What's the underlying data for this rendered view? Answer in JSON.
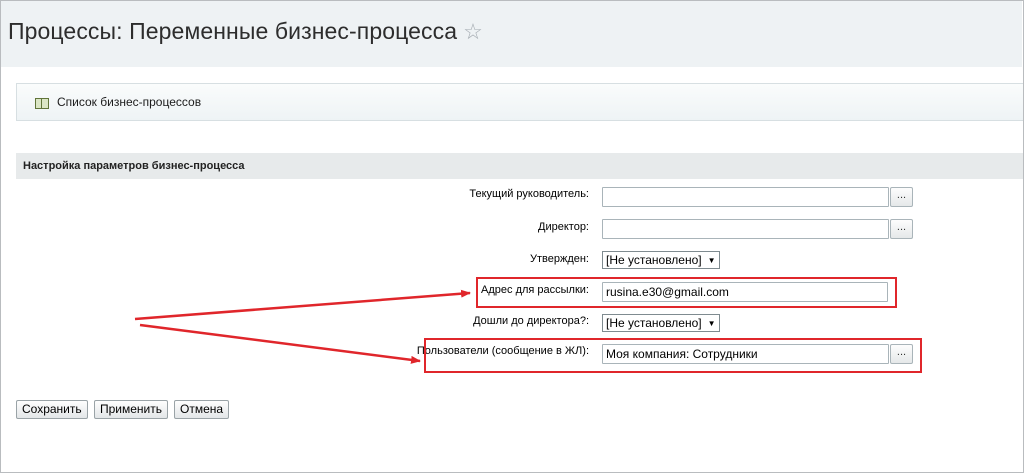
{
  "page": {
    "title": "Процессы: Переменные бизнес-процесса",
    "star_icon": "star-icon"
  },
  "toolbar": {
    "list_link": "Список бизнес-процессов",
    "icon": "book-icon"
  },
  "section": {
    "title": "Настройка параметров бизнес-процесса"
  },
  "fields": {
    "current_manager": {
      "label": "Текущий руководитель:",
      "value": "",
      "button": "..."
    },
    "director": {
      "label": "Директор:",
      "value": "",
      "button": "..."
    },
    "approved": {
      "label": "Утвержден:",
      "value": "[Не установлено]"
    },
    "mailing_address": {
      "label": "Адрес для рассылки:",
      "value": "rusina.e30@gmail.com"
    },
    "reached_director": {
      "label": "Дошли до директора?:",
      "value": "[Не установлено]"
    },
    "users": {
      "label": "Пользователи (сообщение в ЖЛ):",
      "value": "Моя компания: Сотрудники",
      "button": "..."
    }
  },
  "buttons": {
    "save": "Сохранить",
    "apply": "Применить",
    "cancel": "Отмена"
  },
  "colors": {
    "highlight": "#e0262b",
    "header_bg": "#eef2f4",
    "section_bg": "#e7eaeb"
  }
}
